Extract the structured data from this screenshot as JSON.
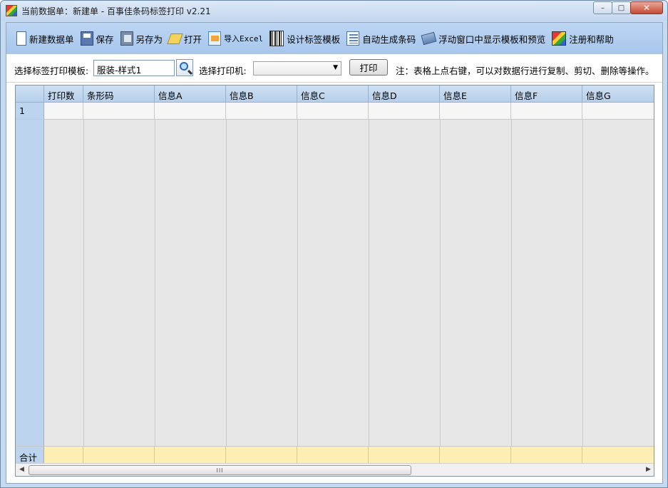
{
  "window": {
    "title": "当前数据单：新建单 - 百事佳条码标签打印 v2.21",
    "buttons": {
      "minimize": "–",
      "maximize": "□",
      "close": "✕"
    }
  },
  "toolbar": {
    "items": [
      {
        "label": "新建数据单",
        "icon": "new-doc-icon"
      },
      {
        "label": "保存",
        "icon": "save-icon"
      },
      {
        "label": "另存为",
        "icon": "save-as-icon"
      },
      {
        "label": "打开",
        "icon": "open-icon"
      },
      {
        "label": "导入Excel",
        "icon": "import-excel-icon"
      },
      {
        "label": "设计标签模板",
        "icon": "barcode-icon"
      },
      {
        "label": "自动生成条码",
        "icon": "list-icon"
      },
      {
        "label": "浮动窗口中显示模板和预览",
        "icon": "float-window-icon"
      },
      {
        "label": "注册和帮助",
        "icon": "help-icon"
      }
    ]
  },
  "options": {
    "template_label": "选择标签打印模板:",
    "template_value": "服装-样式1",
    "printer_label": "选择打印机:",
    "printer_value": "",
    "print_button": "打印",
    "note": "注：表格上点右键，可以对数据行进行复制、剪切、删除等操作。"
  },
  "grid": {
    "columns": [
      "打印数",
      "条形码",
      "信息A",
      "信息B",
      "信息C",
      "信息D",
      "信息E",
      "信息F",
      "信息G"
    ],
    "rows": [
      {
        "row_header": "1",
        "cells": [
          "",
          "",
          "",
          "",
          "",
          "",
          "",
          "",
          ""
        ]
      }
    ],
    "summary_label": "合计",
    "scroll_grip": "III"
  },
  "colors": {
    "toolbar_bg": "#a7c6ec",
    "header_bg": "#bcd4ee",
    "summary_bg": "#fdefb3",
    "grid_empty_bg": "#e7e7e7"
  }
}
